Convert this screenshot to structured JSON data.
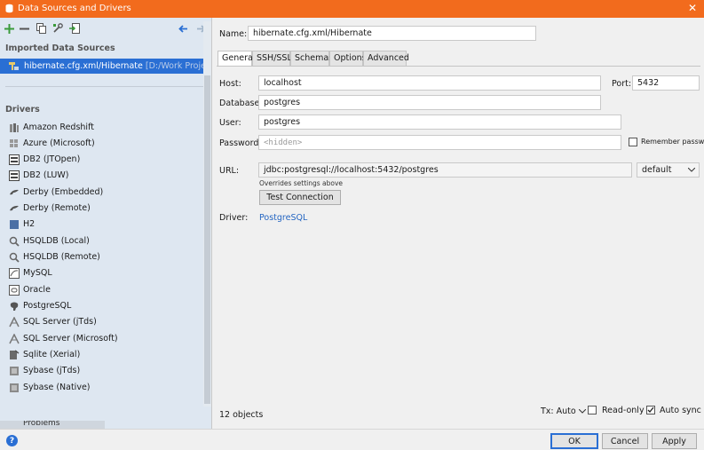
{
  "window": {
    "title": "Data Sources and Drivers",
    "close_glyph": "✕"
  },
  "left": {
    "toolbar": [
      "add-icon",
      "remove-icon",
      "copy-icon",
      "settings-icon",
      "import-icon",
      "back-icon",
      "forward-icon"
    ],
    "imported_heading": "Imported Data Sources",
    "selected_source": {
      "name": "hibernate.cfg.xml/Hibernate",
      "path": "[D:/Work Projects/Proc"
    },
    "drivers_heading": "Drivers",
    "drivers": [
      {
        "label": "Amazon Redshift"
      },
      {
        "label": "Azure (Microsoft)"
      },
      {
        "label": "DB2 (JTOpen)"
      },
      {
        "label": "DB2 (LUW)"
      },
      {
        "label": "Derby (Embedded)"
      },
      {
        "label": "Derby (Remote)"
      },
      {
        "label": "H2"
      },
      {
        "label": "HSQLDB (Local)"
      },
      {
        "label": "HSQLDB (Remote)"
      },
      {
        "label": "MySQL"
      },
      {
        "label": "Oracle"
      },
      {
        "label": "PostgreSQL"
      },
      {
        "label": "SQL Server (jTds)"
      },
      {
        "label": "SQL Server (Microsoft)"
      },
      {
        "label": "Sqlite (Xerial)"
      },
      {
        "label": "Sybase (jTds)"
      },
      {
        "label": "Sybase (Native)"
      }
    ],
    "problems_tab": "Problems"
  },
  "right": {
    "name_label": "Name:",
    "name_value": "hibernate.cfg.xml/Hibernate",
    "tabs": [
      "General",
      "SSH/SSL",
      "Schemas",
      "Options",
      "Advanced"
    ],
    "host_label": "Host:",
    "host_value": "localhost",
    "port_label": "Port:",
    "port_value": "5432",
    "database_label": "Database:",
    "database_value": "postgres",
    "user_label": "User:",
    "user_value": "postgres",
    "password_label": "Password:",
    "password_placeholder": "<hidden>",
    "remember_password": "Remember password",
    "url_label": "URL:",
    "url_value": "jdbc:postgresql://localhost:5432/postgres",
    "url_mode": "default",
    "overrides_note": "Overrides settings above",
    "test_connection": "Test Connection",
    "driver_label": "Driver:",
    "driver_value": "PostgreSQL",
    "objects_count": "12 objects",
    "tx_label": "Tx: Auto",
    "read_only": "Read-only",
    "auto_sync": "Auto sync",
    "auto_sync_checked": true,
    "read_only_checked": false
  },
  "footer": {
    "help": "?",
    "ok": "OK",
    "cancel": "Cancel",
    "apply": "Apply"
  },
  "colors": {
    "title_bar": "#f26b1d",
    "left_panel": "#dee7f1",
    "selection": "#2a6fd4",
    "link": "#2566c2"
  }
}
